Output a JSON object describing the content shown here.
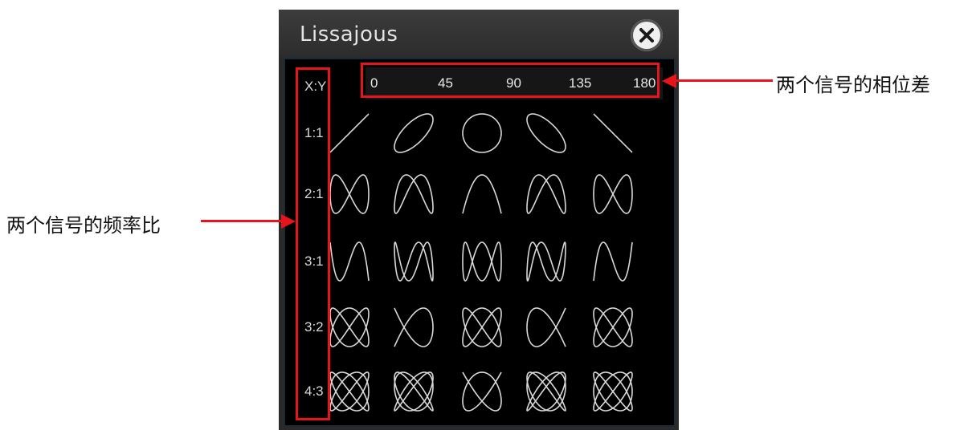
{
  "dialog": {
    "title": "Lissajous",
    "close_icon": "close-icon"
  },
  "table": {
    "corner_header": "X:Y",
    "phase_labels": [
      "0",
      "45",
      "90",
      "135",
      "180"
    ],
    "ratio_labels": [
      "1:1",
      "2:1",
      "3:1",
      "3:2",
      "4:3"
    ],
    "figure_style": "lissajous-curve",
    "figure_color": "#d9d9d9"
  },
  "annotations": {
    "phase_callout": "两个信号的相位差",
    "ratio_callout": "两个信号的频率比",
    "highlight_color": "#e8141c"
  }
}
